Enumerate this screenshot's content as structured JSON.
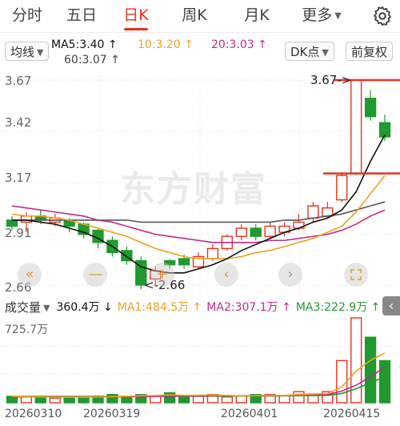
{
  "tabs": [
    {
      "label": "分时"
    },
    {
      "label": "五日"
    },
    {
      "label": "日K"
    },
    {
      "label": "周K"
    },
    {
      "label": "月K"
    },
    {
      "label": "更多"
    }
  ],
  "settings_icon": "gear-icon",
  "indicator_select": "均线",
  "ma": {
    "ma5": "MA5:3.40 ↑",
    "ma10": "10:3.20 ↑",
    "ma20": "20:3.03 ↑",
    "ma60": "60:3.07 ↑"
  },
  "dk_button": "DK点",
  "adjust_button": "前复权",
  "colors": {
    "up": "#e8321f",
    "down": "#1f9a2e",
    "ma5": "#111111",
    "ma10": "#f0a020",
    "ma20": "#c02c8a",
    "ma60": "#555555"
  },
  "price_axis": [
    "3.67",
    "3.42",
    "3.17",
    "2.91",
    "2.66"
  ],
  "high_label": "3.67->",
  "low_label": "<-2.66",
  "watermark": "东方财富",
  "nav": {
    "left_double": "«",
    "minus": "—",
    "plus": "+",
    "left": "‹",
    "right": "›",
    "fullscreen": "expand-icon"
  },
  "volume": {
    "title": "成交量",
    "total": "360.4万 ↓",
    "ma1": "MA1:484.5万 ↑",
    "ma2": "MA2:307.1万 ↑",
    "ma3": "MA3:222.9万 ↑",
    "max_label": "725.7万"
  },
  "dates": [
    "20260310",
    "20260319",
    "20260401",
    "20260415"
  ],
  "chart_data": {
    "type": "candlestick",
    "ylim": [
      2.66,
      3.67
    ],
    "candles": [
      {
        "o": 2.98,
        "c": 2.95,
        "h": 3.0,
        "l": 2.93
      },
      {
        "o": 2.97,
        "c": 3.0,
        "h": 3.02,
        "l": 2.92
      },
      {
        "o": 3.0,
        "c": 2.98,
        "h": 3.03,
        "l": 2.96
      },
      {
        "o": 2.97,
        "c": 2.99,
        "h": 3.01,
        "l": 2.95
      },
      {
        "o": 2.98,
        "c": 2.95,
        "h": 2.99,
        "l": 2.92
      },
      {
        "o": 2.96,
        "c": 2.91,
        "h": 2.97,
        "l": 2.89
      },
      {
        "o": 2.93,
        "c": 2.87,
        "h": 2.94,
        "l": 2.84
      },
      {
        "o": 2.88,
        "c": 2.82,
        "h": 2.9,
        "l": 2.8
      },
      {
        "o": 2.83,
        "c": 2.78,
        "h": 2.85,
        "l": 2.76
      },
      {
        "o": 2.78,
        "c": 2.66,
        "h": 2.8,
        "l": 2.64
      },
      {
        "o": 2.69,
        "c": 2.73,
        "h": 2.75,
        "l": 2.66
      },
      {
        "o": 2.78,
        "c": 2.76,
        "h": 2.79,
        "l": 2.74
      },
      {
        "o": 2.79,
        "c": 2.76,
        "h": 2.81,
        "l": 2.74
      },
      {
        "o": 2.75,
        "c": 2.8,
        "h": 2.82,
        "l": 2.74
      },
      {
        "o": 2.79,
        "c": 2.84,
        "h": 2.86,
        "l": 2.78
      },
      {
        "o": 2.84,
        "c": 2.9,
        "h": 2.91,
        "l": 2.83
      },
      {
        "o": 2.9,
        "c": 2.94,
        "h": 2.96,
        "l": 2.88
      },
      {
        "o": 2.94,
        "c": 2.9,
        "h": 2.96,
        "l": 2.88
      },
      {
        "o": 2.9,
        "c": 2.95,
        "h": 2.97,
        "l": 2.89
      },
      {
        "o": 2.92,
        "c": 2.95,
        "h": 2.97,
        "l": 2.9
      },
      {
        "o": 2.94,
        "c": 2.97,
        "h": 3.01,
        "l": 2.93
      },
      {
        "o": 2.99,
        "c": 3.05,
        "h": 3.07,
        "l": 2.97
      },
      {
        "o": 3.0,
        "c": 3.04,
        "h": 3.07,
        "l": 2.99
      },
      {
        "o": 3.08,
        "c": 3.2,
        "h": 3.21,
        "l": 3.07
      },
      {
        "o": 3.21,
        "c": 3.67,
        "h": 3.67,
        "l": 3.2
      },
      {
        "o": 3.58,
        "c": 3.49,
        "h": 3.62,
        "l": 3.47
      },
      {
        "o": 3.46,
        "c": 3.39,
        "h": 3.5,
        "l": 3.37
      }
    ],
    "ma5": [
      2.98,
      2.98,
      2.97,
      2.96,
      2.94,
      2.92,
      2.89,
      2.85,
      2.8,
      2.75,
      2.73,
      2.72,
      2.72,
      2.74,
      2.76,
      2.79,
      2.83,
      2.86,
      2.89,
      2.92,
      2.94,
      2.97,
      2.99,
      3.03,
      3.12,
      3.27,
      3.4
    ],
    "ma10": [
      3.01,
      3.0,
      3.0,
      2.99,
      2.98,
      2.96,
      2.94,
      2.92,
      2.9,
      2.87,
      2.84,
      2.82,
      2.8,
      2.79,
      2.79,
      2.79,
      2.8,
      2.82,
      2.83,
      2.85,
      2.87,
      2.89,
      2.92,
      2.95,
      3.02,
      3.11,
      3.2
    ],
    "ma20": [
      3.05,
      3.04,
      3.03,
      3.02,
      3.01,
      3.0,
      2.98,
      2.97,
      2.95,
      2.93,
      2.91,
      2.9,
      2.89,
      2.88,
      2.87,
      2.87,
      2.87,
      2.87,
      2.88,
      2.88,
      2.89,
      2.9,
      2.91,
      2.93,
      2.96,
      3.0,
      3.03
    ],
    "ma60": [
      2.98,
      2.98,
      2.98,
      2.98,
      2.98,
      2.98,
      2.98,
      2.98,
      2.98,
      2.97,
      2.97,
      2.97,
      2.97,
      2.97,
      2.97,
      2.97,
      2.97,
      2.97,
      2.97,
      2.98,
      2.98,
      2.99,
      3.0,
      3.01,
      3.03,
      3.05,
      3.07
    ],
    "volume": [
      55,
      50,
      45,
      40,
      50,
      45,
      55,
      70,
      55,
      70,
      60,
      85,
      50,
      55,
      70,
      50,
      60,
      70,
      70,
      60,
      95,
      75,
      95,
      360,
      725,
      560,
      360
    ],
    "vol_ma1": [
      55,
      52,
      50,
      48,
      48,
      48,
      49,
      52,
      55,
      60,
      62,
      68,
      64,
      64,
      67,
      63,
      59,
      60,
      64,
      62,
      71,
      74,
      79,
      137,
      270,
      363,
      425
    ],
    "vol_ma2": [
      50,
      50,
      50,
      50,
      50,
      50,
      50,
      50,
      52,
      53,
      54,
      57,
      58,
      58,
      60,
      60,
      60,
      61,
      62,
      62,
      66,
      67,
      70,
      100,
      150,
      220,
      307
    ],
    "vol_ma3": [
      55,
      55,
      55,
      54,
      54,
      54,
      54,
      54,
      54,
      55,
      55,
      56,
      56,
      56,
      57,
      57,
      58,
      58,
      58,
      59,
      61,
      62,
      63,
      80,
      120,
      170,
      223
    ]
  }
}
